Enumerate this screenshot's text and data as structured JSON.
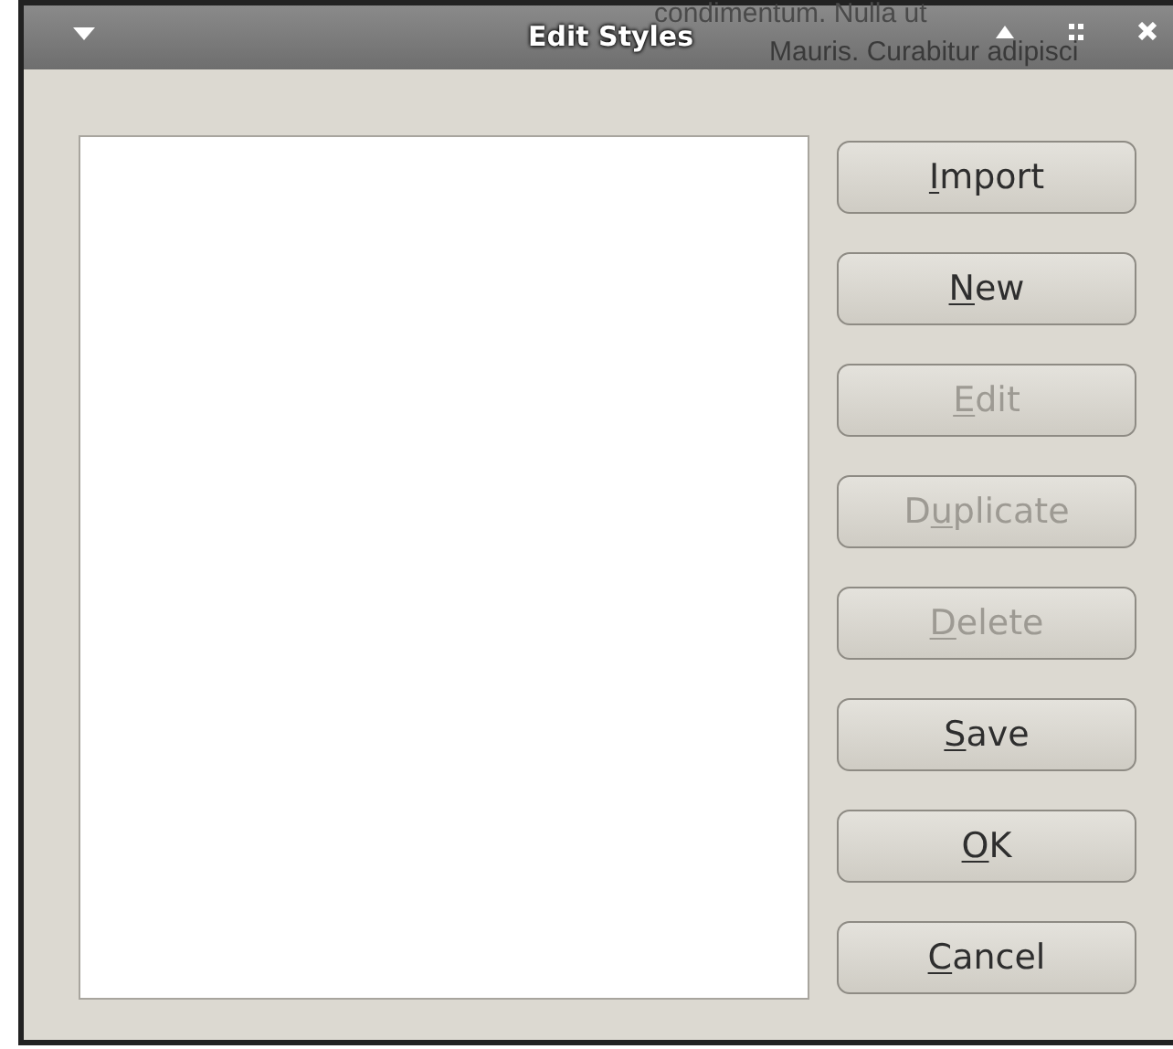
{
  "window": {
    "title": "Edit Styles"
  },
  "background_text": [
    "condimentum. Nulla ut",
    "Mauris. Curabitur adipisci"
  ],
  "buttons": [
    {
      "accel": "I",
      "after": "mport",
      "disabled": false
    },
    {
      "accel": "N",
      "after": "ew",
      "disabled": false
    },
    {
      "accel": "E",
      "after": "dit",
      "disabled": true
    },
    {
      "before": "D",
      "accel": "u",
      "after": "plicate",
      "disabled": true
    },
    {
      "accel": "D",
      "after": "elete",
      "disabled": true
    },
    {
      "accel": "S",
      "after": "ave",
      "disabled": false
    },
    {
      "accel": "O",
      "after": "K",
      "disabled": false
    },
    {
      "accel": "C",
      "after": "ancel",
      "disabled": false
    }
  ]
}
